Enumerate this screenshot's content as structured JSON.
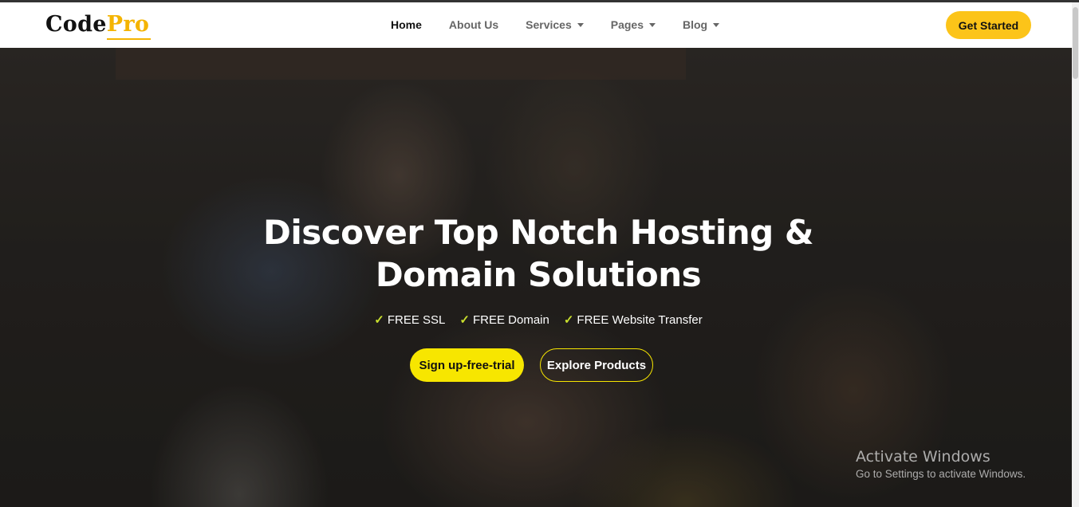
{
  "brand": {
    "logo_main": "Code",
    "logo_accent": "Pro"
  },
  "nav": {
    "items": [
      {
        "label": "Home",
        "active": true,
        "dropdown": false
      },
      {
        "label": "About Us",
        "active": false,
        "dropdown": false
      },
      {
        "label": "Services",
        "active": false,
        "dropdown": true
      },
      {
        "label": "Pages",
        "active": false,
        "dropdown": true
      },
      {
        "label": "Blog",
        "active": false,
        "dropdown": true
      }
    ],
    "cta_label": "Get Started"
  },
  "hero": {
    "title_line1": "Discover Top Notch Hosting &",
    "title_line2": "Domain Solutions",
    "features": [
      "FREE SSL",
      "FREE Domain",
      "FREE Website Transfer"
    ],
    "primary_button": "Sign up-free-trial",
    "secondary_button": "Explore Products"
  },
  "watermark": {
    "title": "Activate Windows",
    "subtitle": "Go to Settings to activate Windows."
  },
  "colors": {
    "accent": "#fcc419",
    "primary_button": "#f7e600",
    "check": "#c9df2e"
  }
}
